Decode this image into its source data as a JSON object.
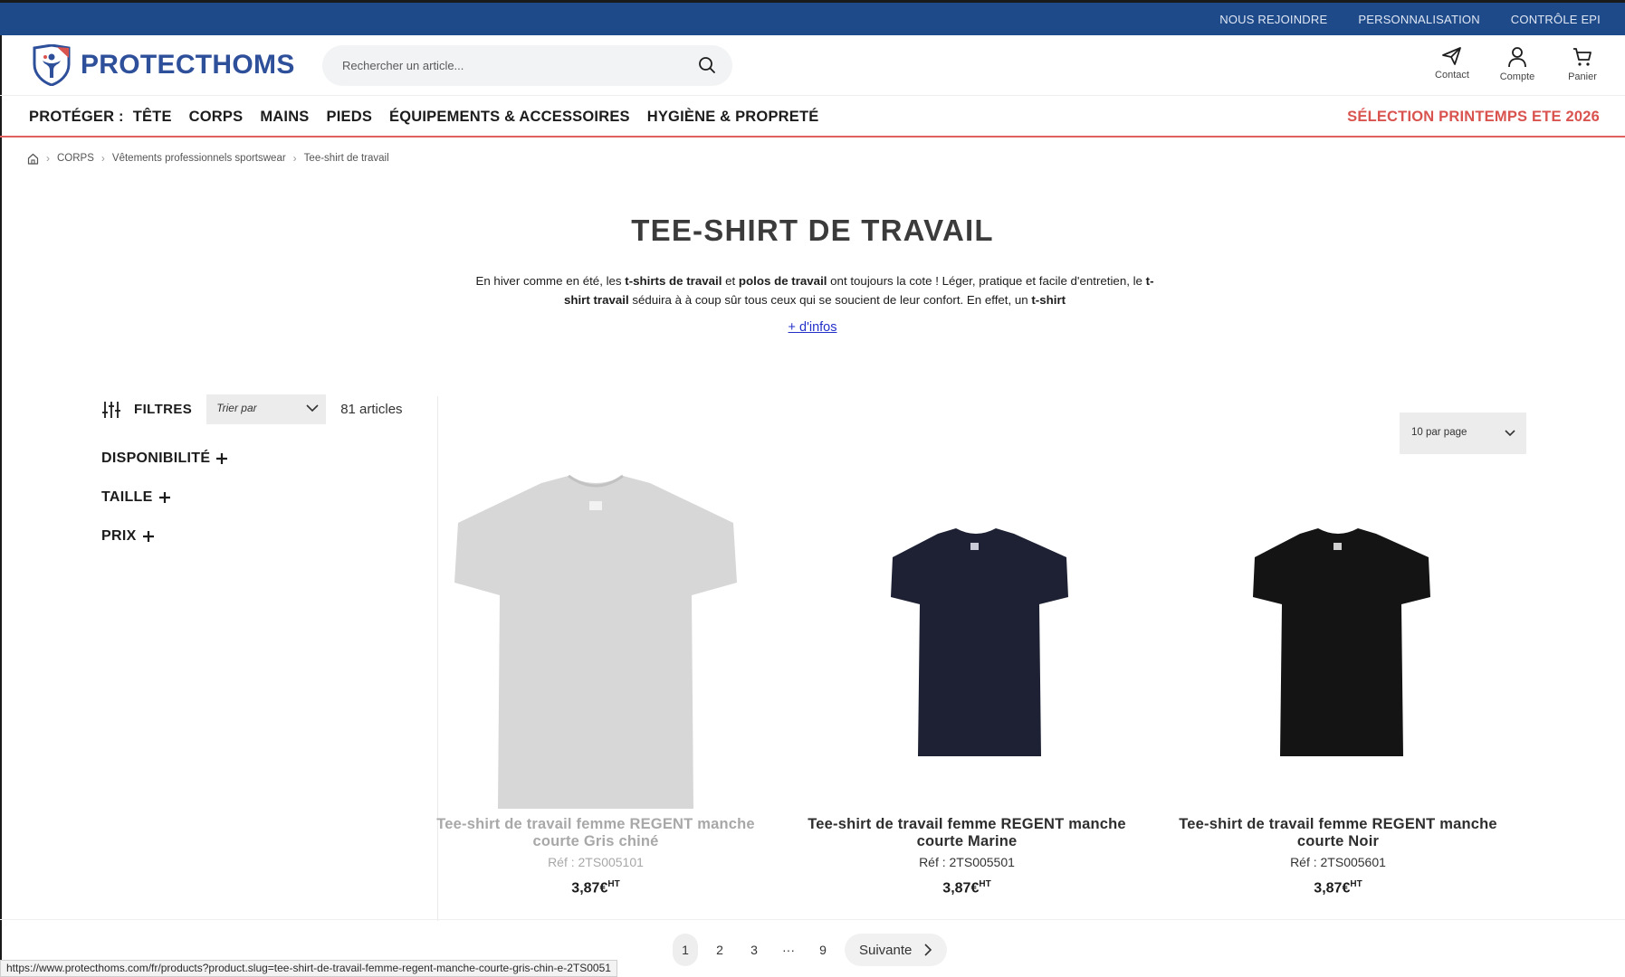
{
  "topbar": {
    "links": [
      "NOUS REJOINDRE",
      "PERSONNALISATION",
      "CONTRÔLE EPI"
    ]
  },
  "header": {
    "logo_text": "PROTECTHOMS",
    "search_placeholder": "Rechercher un article...",
    "actions": {
      "contact": "Contact",
      "account": "Compte",
      "cart": "Panier"
    }
  },
  "nav": {
    "lead": "PROTÉGER :",
    "items": [
      "TÊTE",
      "CORPS",
      "MAINS",
      "PIEDS",
      "ÉQUIPEMENTS & ACCESSOIRES",
      "HYGIÈNE & PROPRETÉ"
    ],
    "promo": "SÉLECTION PRINTEMPS ETE 2026"
  },
  "breadcrumb": [
    "CORPS",
    "Vêtements professionnels sportswear",
    "Tee-shirt de travail"
  ],
  "page": {
    "title": "TEE-SHIRT DE TRAVAIL",
    "intro": {
      "t1": "En hiver comme en été, les ",
      "b1": "t-shirts de travail",
      "t2": " et ",
      "b2": "polos de travail",
      "t3": " ont toujours la cote ! Léger, pratique et facile d'entretien, le ",
      "b3": "t-shirt travail",
      "t4": " séduira à à coup sûr tous ceux qui se soucient de leur confort. En effet, un ",
      "b4": "t-shirt"
    },
    "more_link": "+ d'infos"
  },
  "filters": {
    "label": "FILTRES",
    "sort_placeholder": "Trier par",
    "count": "81 articles",
    "facets": [
      "DISPONIBILITÉ",
      "TAILLE",
      "PRIX"
    ],
    "per_page": "10 par page"
  },
  "products": [
    {
      "name": "Tee-shirt de travail femme REGENT manche courte Gris chiné",
      "ref": "Réf : 2TS005101",
      "price": "3,87€",
      "price_suffix": "HT",
      "color": "#d7d7d7"
    },
    {
      "name": "Tee-shirt de travail femme REGENT manche courte Marine",
      "ref": "Réf : 2TS005501",
      "price": "3,87€",
      "price_suffix": "HT",
      "color": "#1d2133"
    },
    {
      "name": "Tee-shirt de travail femme REGENT manche courte Noir",
      "ref": "Réf : 2TS005601",
      "price": "3,87€",
      "price_suffix": "HT",
      "color": "#141414"
    }
  ],
  "pagination": {
    "pages": [
      "1",
      "2",
      "3",
      "···",
      "9"
    ],
    "next": "Suivante",
    "current": "1"
  },
  "status_url": "https://www.protecthoms.com/fr/products?product.slug=tee-shirt-de-travail-femme-regent-manche-courte-gris-chin-e-2TS0051",
  "colors": {
    "topbar": "#1f4a8a",
    "brand": "#2e4f9a",
    "promo": "#d9534f",
    "link": "#2230c9"
  }
}
